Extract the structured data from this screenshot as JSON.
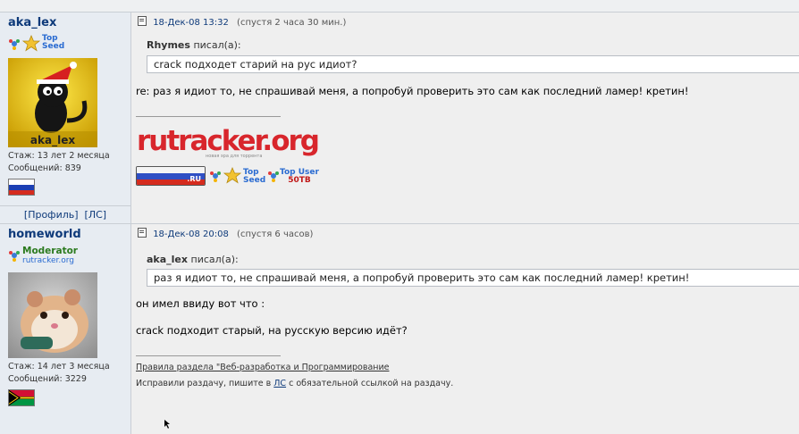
{
  "posts": [
    {
      "author": "aka_lex",
      "rank": {
        "line1": "Top",
        "line2": "Seed"
      },
      "avatar_caption": "aka_lex",
      "stats": {
        "experience": "Стаж: 13 лет 2 месяца",
        "messages": "Сообщений: 839"
      },
      "profile_links": {
        "profile": "[Профиль]",
        "pm": "[ЛС]"
      },
      "date": "18-Дек-08 13:32",
      "ago": "(спустя 2 часа 30 мин.)",
      "quote": {
        "author": "Rhymes",
        "wrote": "писал(а):",
        "text": "crack подходет старий на рус идиот?"
      },
      "body": "re: раз я идиот то, не спрашивай меня, а попробуй проверить это сам как последний ламер! кретин!",
      "signature": {
        "logo_text": "rutracker.org",
        "logo_tagline": "новая эра для торрента",
        "badge_ru": ".RU",
        "rank_top_seed": {
          "line1": "Top",
          "line2": "Seed"
        },
        "rank_top_user": {
          "line1": "Top User",
          "line2": "50TB"
        }
      },
      "colors": {
        "flag_top": "#ffffff",
        "flag_mid": "#1c3fb4",
        "flag_bot": "#d52b1e"
      }
    },
    {
      "author": "homeworld",
      "rank": {
        "line1": "Moderator",
        "line2": "rutracker.org"
      },
      "stats": {
        "experience": "Стаж: 14 лет 3 месяца",
        "messages": "Сообщений: 3229"
      },
      "date": "18-Дек-08 20:08",
      "ago": "(спустя 6 часов)",
      "quote": {
        "author": "aka_lex",
        "wrote": "писал(а):",
        "text": "раз я идиот то, не спрашивай меня, а попробуй проверить это сам как последний ламер! кретин!"
      },
      "body_line1": "он имел ввиду вот что :",
      "body_line2": "crack подходит старый, на русскую версию идёт?",
      "signature": {
        "rules_link": "Правила раздела \"Веб-разработка и Программирование",
        "note_before": "Исправили раздачу, пишите в",
        "note_link": "ЛС",
        "note_after": "с обязательной ссылкой на раздачу."
      }
    }
  ],
  "theme": {
    "nick_color": "#0e3a7a",
    "sidebar_bg": "#e7ecf2",
    "post_bg": "#efefef",
    "logo_red": "#d8262c",
    "logo_green": "#3d8c2f"
  }
}
